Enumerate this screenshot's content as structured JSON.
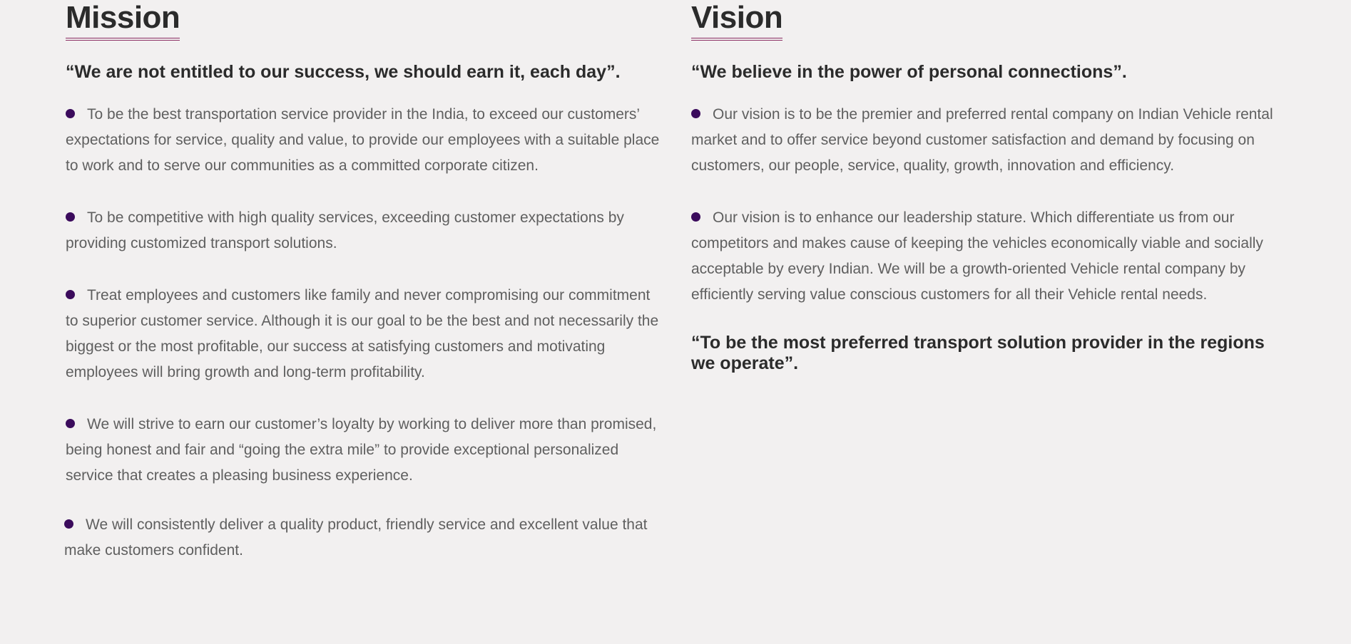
{
  "colors": {
    "background": "#f2f0f0",
    "heading": "#2b2b2b",
    "body_text": "#5f5f5f",
    "bullet": "#3b0b5c",
    "title_underline": "#8a2c62"
  },
  "mission": {
    "title": "Mission",
    "quote": "“We are not entitled to our success, we should earn it, each day”.",
    "items": [
      "To be the best transportation service provider in the India, to exceed our customers’ expectations for service, quality and value, to provide our employees with a suitable place to work and to serve our communities as a committed corporate citizen.",
      "To be competitive with high quality services, exceeding customer expectations by providing customized transport solutions.",
      "Treat employees and customers like family and never compromising our commitment to superior customer service. Although it is our goal to be the best and not necessarily the biggest or the most profitable, our success at satisfying customers and motivating employees will bring growth and long-term profitability.",
      "We will strive to earn our customer’s loyalty by working to deliver more than promised, being honest and fair and “going the extra mile” to provide exceptional personalized service that creates a pleasing business experience.",
      "We will consistently deliver a quality product, friendly service and excellent value that make customers confident."
    ]
  },
  "vision": {
    "title": "Vision",
    "quote": "“We believe in the power of personal connections”.",
    "items": [
      "Our vision is to be the premier and preferred rental company on Indian Vehicle rental market and to offer service beyond customer satisfaction and demand by focusing on customers, our people, service, quality, growth, innovation and efficiency.",
      "Our vision is to enhance our leadership stature. Which differentiate us from our competitors and makes cause of keeping the vehicles economically viable and socially acceptable by every Indian. We will be a growth-oriented Vehicle rental company by efficiently serving value conscious customers for all their Vehicle rental needs."
    ],
    "closing_quote": "“To be the most preferred transport solution provider in the regions we operate”."
  }
}
